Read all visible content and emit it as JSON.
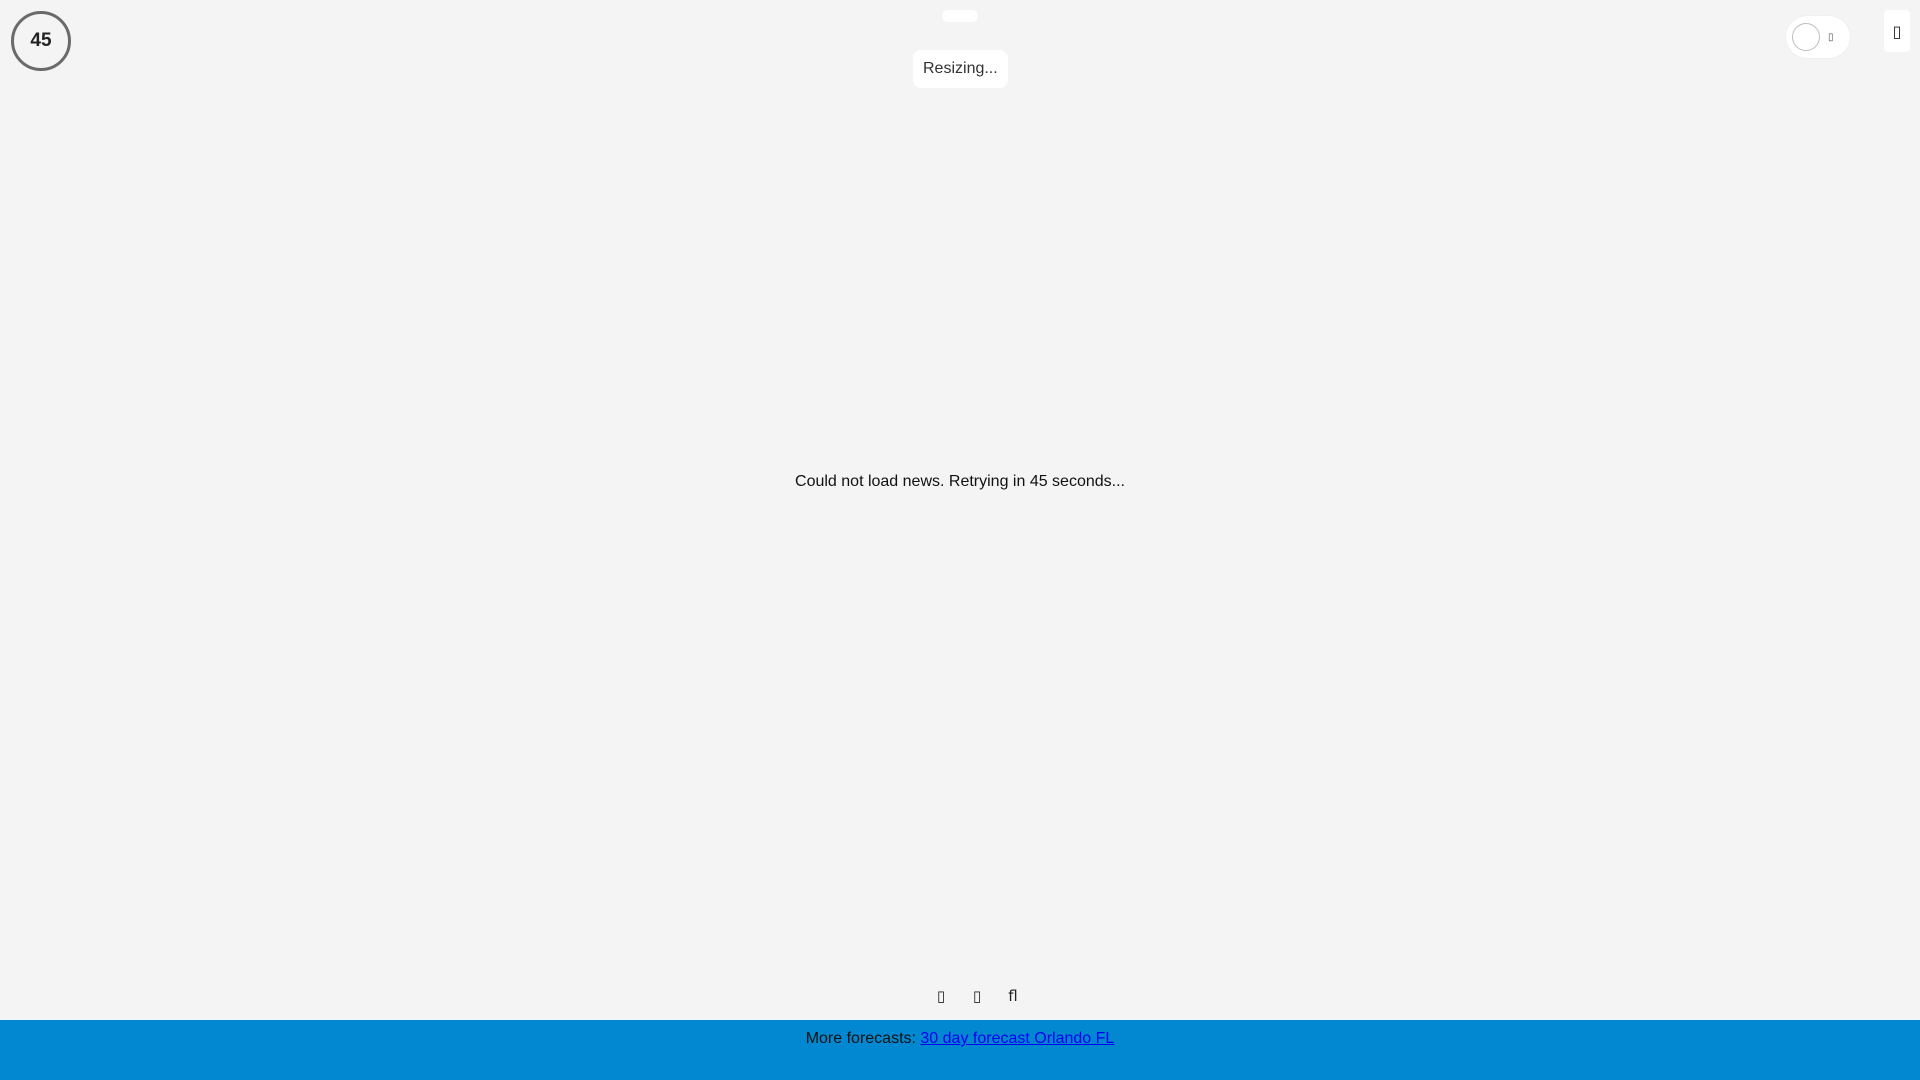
{
  "countdown": {
    "value": "45"
  },
  "status": {
    "message": "Resizing..."
  },
  "theme_toggle": {
    "icon": "moon-icon",
    "glyph": "▯"
  },
  "menu": {
    "icon": "menu-icon",
    "glyph": "▯"
  },
  "news": {
    "message": "Could not load news. Retrying in 45 seconds..."
  },
  "toolbar": {
    "items": [
      {
        "icon": "placeholder-icon",
        "glyph": "▯"
      },
      {
        "icon": "placeholder-icon",
        "glyph": "▯"
      },
      {
        "icon": "search-icon",
        "glyph": "fl"
      }
    ]
  },
  "footer": {
    "prefix": "More forecasts: ",
    "link_text": "30 day forecast Orlando FL",
    "bg_color": "#0288d1"
  }
}
